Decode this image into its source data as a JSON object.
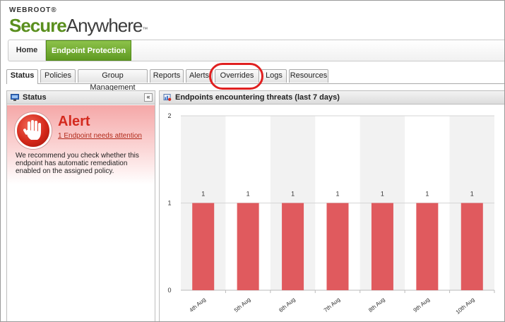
{
  "logo": {
    "top": "WEBROOT",
    "reg": "®",
    "secure": "Secure",
    "anywhere": "Anywhere",
    "tm": "™"
  },
  "mainnav": {
    "home": "Home",
    "endpoint_protection": "Endpoint Protection"
  },
  "tabs": [
    "Status",
    "Policies",
    "Group Management",
    "Reports",
    "Alerts",
    "Overrides",
    "Logs",
    "Resources"
  ],
  "active_tab": "Status",
  "highlighted_tab": "Overrides",
  "status_panel": {
    "title": "Status",
    "collapse": "«",
    "alert_title": "Alert",
    "alert_link": "1 Endpoint needs attention",
    "alert_text": "We recommend you check whether this endpoint has automatic remediation enabled on the assigned policy."
  },
  "chart_panel": {
    "title": "Endpoints encountering threats (last 7 days)"
  },
  "chart_data": {
    "type": "bar",
    "categories": [
      "4th Aug",
      "5th Aug",
      "6th Aug",
      "7th Aug",
      "8th Aug",
      "9th Aug",
      "10th Aug"
    ],
    "values": [
      1,
      1,
      1,
      1,
      1,
      1,
      1
    ],
    "data_labels": [
      "1",
      "1",
      "1",
      "1",
      "1",
      "1",
      "1"
    ],
    "ylim": [
      0,
      2
    ],
    "yticks": [
      0,
      1,
      2
    ],
    "bar_color": "#e05a5e",
    "grid": true,
    "alternating_bands": true
  },
  "colors": {
    "accent_green": "#6aa82a",
    "alert_red": "#d42a1e",
    "highlight_ring": "#e02020"
  },
  "icons": {
    "status_panel_icon": "monitor-icon",
    "chart_panel_icon": "chart-report-icon",
    "alert_icon": "stop-hand-icon"
  }
}
